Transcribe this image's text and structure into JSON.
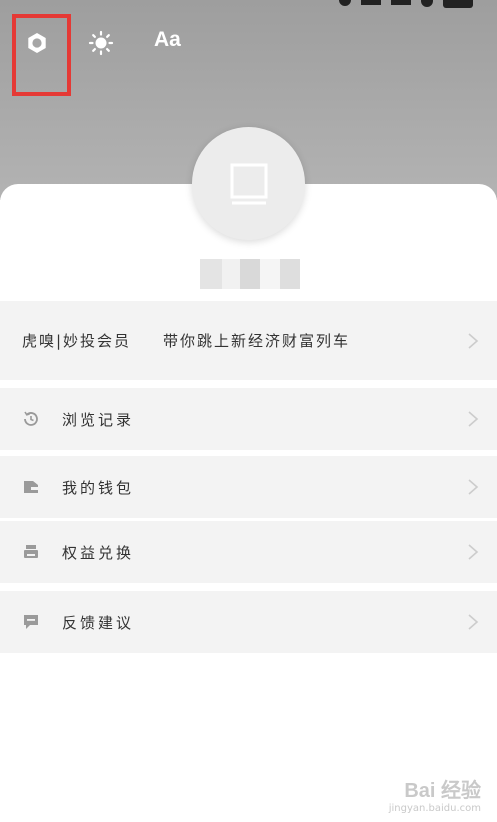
{
  "header": {
    "font_button_label": "Aa"
  },
  "vip_banner": {
    "label": "虎嗅|妙投会员",
    "tagline": "带你跳上新经济财富列车"
  },
  "menu": {
    "items": [
      {
        "label": "浏览记录",
        "icon": "history-icon"
      },
      {
        "label": "我的钱包",
        "icon": "wallet-icon"
      },
      {
        "label": "权益兑换",
        "icon": "printer-icon"
      },
      {
        "label": "反馈建议",
        "icon": "feedback-icon"
      }
    ]
  },
  "watermark": {
    "brand": "Bai 经验",
    "url": "jingyan.baidu.com"
  },
  "colors": {
    "header_gray": "#a8a8a8",
    "row_bg": "#f3f3f3",
    "highlight": "#e53935"
  }
}
